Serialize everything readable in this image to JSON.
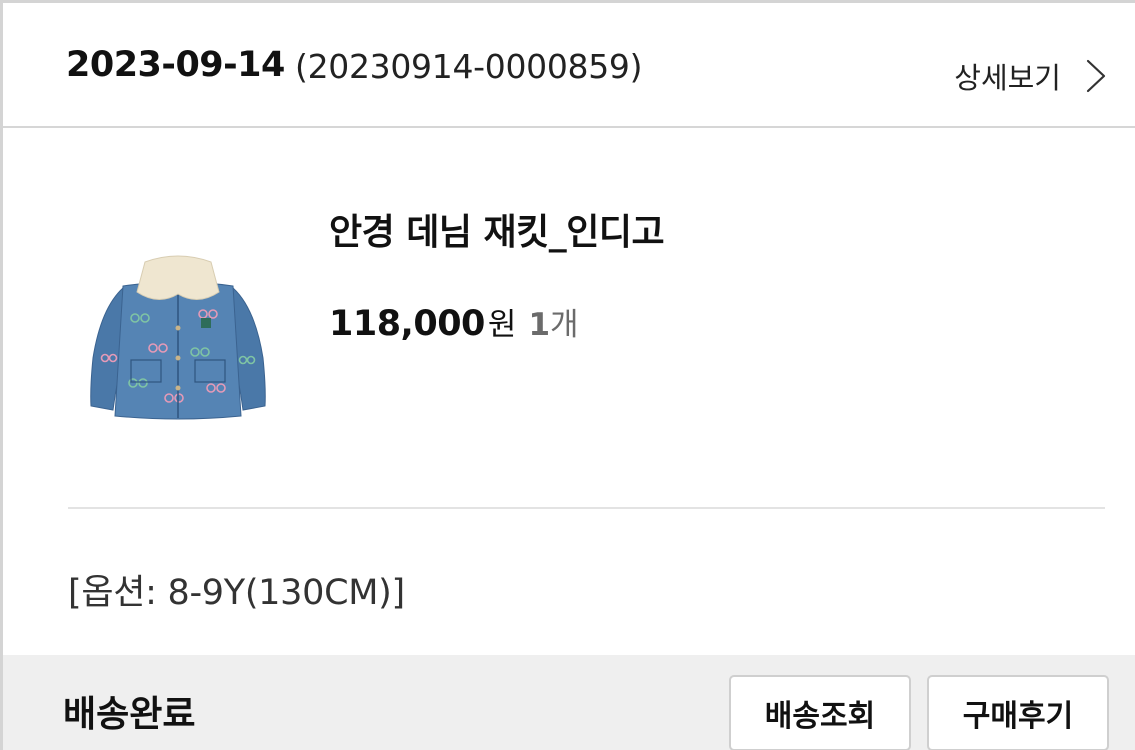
{
  "order": {
    "date": "2023-09-14",
    "number": "(20230914-0000859)",
    "detail_link_label": "상세보기"
  },
  "product": {
    "name": "안경 데님 재킷_인디고",
    "price": "118,000",
    "currency": "원",
    "quantity": "1",
    "quantity_unit": "개",
    "option": "[옵션: 8-9Y(130CM)]"
  },
  "status": {
    "label": "배송완료",
    "buttons": {
      "track_label": "배송조회",
      "review_label": "구매후기"
    }
  },
  "icons": {
    "chevron": "chevron-right-icon"
  },
  "colors": {
    "denim": "#4a78a8",
    "collar": "#efe6d0",
    "status_bar": "#efefef",
    "muted_text": "#6b6b6b"
  }
}
